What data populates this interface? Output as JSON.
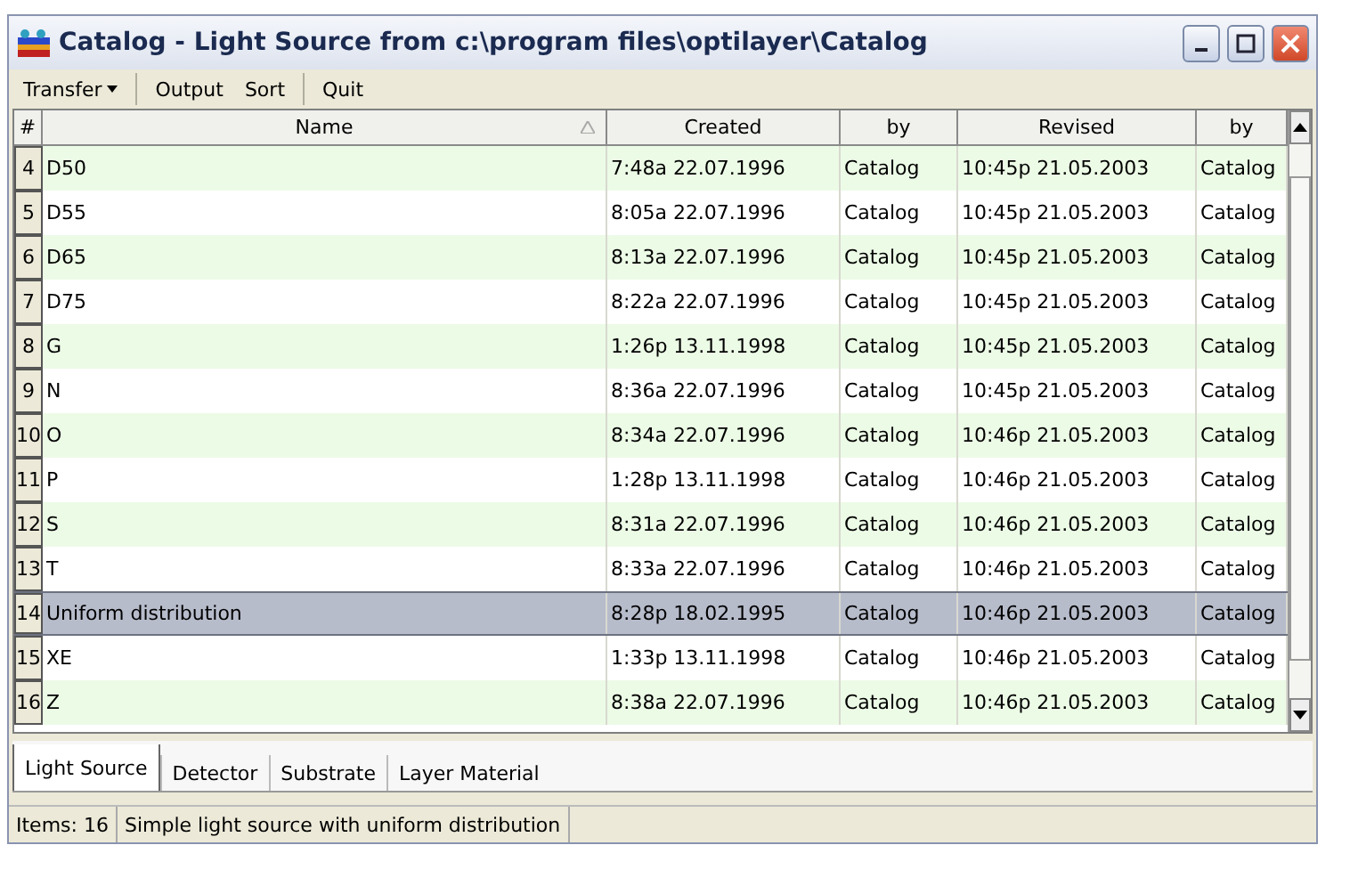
{
  "window": {
    "title": "Catalog - Light Source from c:\\program files\\optilayer\\Catalog"
  },
  "toolbar": [
    {
      "label": "Transfer",
      "kind": "dropdown"
    },
    {
      "label": "Output",
      "kind": "button"
    },
    {
      "label": "Sort",
      "kind": "button"
    },
    {
      "label": "Quit",
      "kind": "button"
    }
  ],
  "table": {
    "columns": [
      "#",
      "Name",
      "Created",
      "by",
      "Revised",
      "by"
    ],
    "rows": [
      {
        "cells": [
          "4",
          "D50",
          "7:48a 22.07.1996",
          "Catalog",
          "10:45p 21.05.2003",
          "Catalog"
        ],
        "selected": false
      },
      {
        "cells": [
          "5",
          "D55",
          "8:05a 22.07.1996",
          "Catalog",
          "10:45p 21.05.2003",
          "Catalog"
        ],
        "selected": false
      },
      {
        "cells": [
          "6",
          "D65",
          "8:13a 22.07.1996",
          "Catalog",
          "10:45p 21.05.2003",
          "Catalog"
        ],
        "selected": false
      },
      {
        "cells": [
          "7",
          "D75",
          "8:22a 22.07.1996",
          "Catalog",
          "10:45p 21.05.2003",
          "Catalog"
        ],
        "selected": false
      },
      {
        "cells": [
          "8",
          "G",
          "1:26p 13.11.1998",
          "Catalog",
          "10:45p 21.05.2003",
          "Catalog"
        ],
        "selected": false
      },
      {
        "cells": [
          "9",
          "N",
          "8:36a 22.07.1996",
          "Catalog",
          "10:45p 21.05.2003",
          "Catalog"
        ],
        "selected": false
      },
      {
        "cells": [
          "10",
          "O",
          "8:34a 22.07.1996",
          "Catalog",
          "10:46p 21.05.2003",
          "Catalog"
        ],
        "selected": false
      },
      {
        "cells": [
          "11",
          "P",
          "1:28p 13.11.1998",
          "Catalog",
          "10:46p 21.05.2003",
          "Catalog"
        ],
        "selected": false
      },
      {
        "cells": [
          "12",
          "S",
          "8:31a 22.07.1996",
          "Catalog",
          "10:46p 21.05.2003",
          "Catalog"
        ],
        "selected": false
      },
      {
        "cells": [
          "13",
          "T",
          "8:33a 22.07.1996",
          "Catalog",
          "10:46p 21.05.2003",
          "Catalog"
        ],
        "selected": false
      },
      {
        "cells": [
          "14",
          "Uniform distribution",
          "8:28p 18.02.1995",
          "Catalog",
          "10:46p 21.05.2003",
          "Catalog"
        ],
        "selected": true
      },
      {
        "cells": [
          "15",
          "XE",
          "1:33p 13.11.1998",
          "Catalog",
          "10:46p 21.05.2003",
          "Catalog"
        ],
        "selected": false
      },
      {
        "cells": [
          "16",
          "Z",
          "8:38a 22.07.1996",
          "Catalog",
          "10:46p 21.05.2003",
          "Catalog"
        ],
        "selected": false
      }
    ]
  },
  "tabs": [
    {
      "label": "Light Source",
      "selected": true
    },
    {
      "label": "Detector",
      "selected": false
    },
    {
      "label": "Substrate",
      "selected": false
    },
    {
      "label": "Layer Material",
      "selected": false
    }
  ],
  "status_bar": [
    "Items: 16",
    "Simple light source with uniform distribution"
  ]
}
